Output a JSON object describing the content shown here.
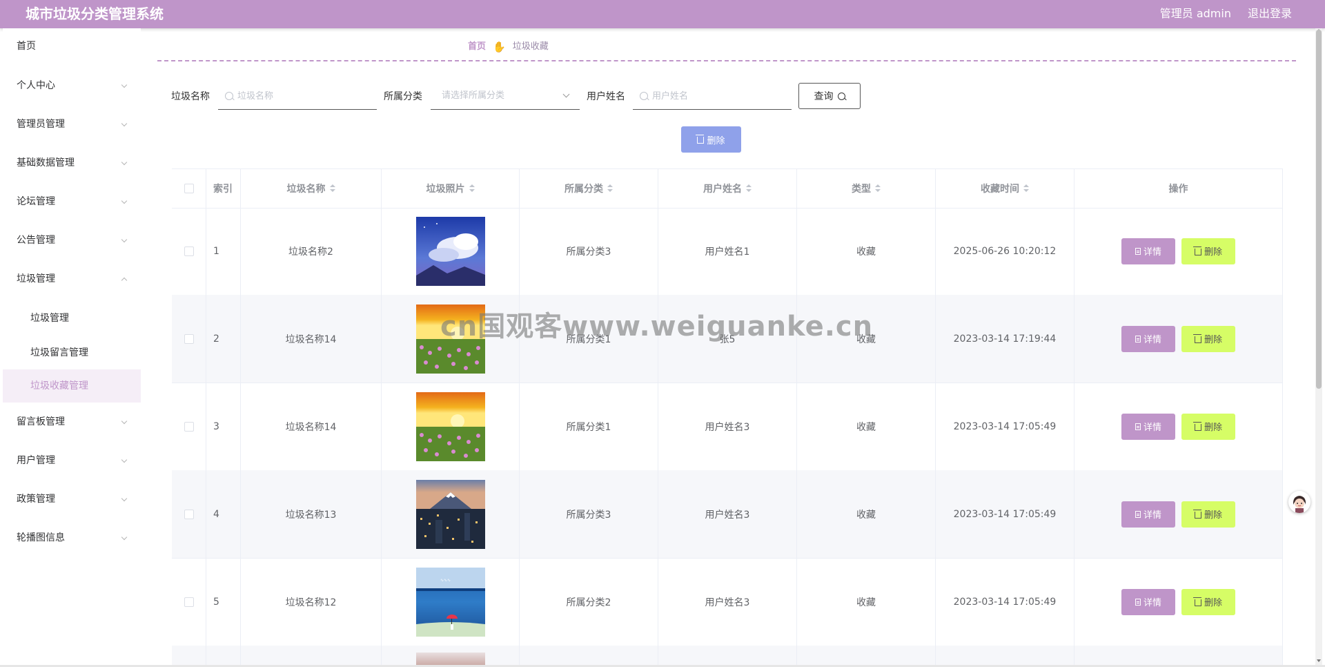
{
  "app": {
    "title": "城市垃圾分类管理系统"
  },
  "header": {
    "user_label": "管理员 admin",
    "logout_label": "退出登录"
  },
  "sidebar": {
    "items": [
      {
        "label": "首页",
        "expandable": false
      },
      {
        "label": "个人中心",
        "expandable": true
      },
      {
        "label": "管理员管理",
        "expandable": true
      },
      {
        "label": "基础数据管理",
        "expandable": true
      },
      {
        "label": "论坛管理",
        "expandable": true
      },
      {
        "label": "公告管理",
        "expandable": true
      },
      {
        "label": "垃圾管理",
        "expandable": true,
        "expanded": true
      },
      {
        "label": "垃圾管理",
        "sub": true
      },
      {
        "label": "垃圾留言管理",
        "sub": true
      },
      {
        "label": "垃圾收藏管理",
        "sub": true,
        "active": true
      },
      {
        "label": "留言板管理",
        "expandable": true
      },
      {
        "label": "用户管理",
        "expandable": true
      },
      {
        "label": "政策管理",
        "expandable": true
      },
      {
        "label": "轮播图信息",
        "expandable": true
      }
    ]
  },
  "breadcrumb": {
    "home": "首页",
    "separator_icon": "hand-pointer-icon",
    "current": "垃圾收藏"
  },
  "search": {
    "name_label": "垃圾名称",
    "name_placeholder": "垃圾名称",
    "category_label": "所属分类",
    "category_placeholder": "请选择所属分类",
    "user_label": "用户姓名",
    "user_placeholder": "用户姓名",
    "query_label": "查询"
  },
  "toolbar": {
    "delete_label": "删除"
  },
  "table": {
    "headers": {
      "index": "索引",
      "name": "垃圾名称",
      "photo": "垃圾照片",
      "category": "所属分类",
      "user": "用户姓名",
      "type": "类型",
      "time": "收藏时间",
      "actions": "操作"
    },
    "rows": [
      {
        "index": "1",
        "name": "垃圾名称2",
        "photo": "anime-sky-clouds",
        "category": "所属分类3",
        "user": "用户姓名1",
        "type": "收藏",
        "time": "2025-06-26 10:20:12"
      },
      {
        "index": "2",
        "name": "垃圾名称14",
        "photo": "sunset-flower-field",
        "category": "所属分类1",
        "user": "张5",
        "type": "收藏",
        "time": "2023-03-14 17:19:44"
      },
      {
        "index": "3",
        "name": "垃圾名称14",
        "photo": "sunset-flower-field",
        "category": "所属分类1",
        "user": "用户姓名3",
        "type": "收藏",
        "time": "2023-03-14 17:05:49"
      },
      {
        "index": "4",
        "name": "垃圾名称13",
        "photo": "mountain-city-night",
        "category": "所属分类3",
        "user": "用户姓名3",
        "type": "收藏",
        "time": "2023-03-14 17:05:49"
      },
      {
        "index": "5",
        "name": "垃圾名称12",
        "photo": "blue-sea-umbrella",
        "category": "所属分类2",
        "user": "用户姓名3",
        "type": "收藏",
        "time": "2023-03-14 17:05:49"
      }
    ],
    "detail_label": "详情",
    "row_delete_label": "删除"
  },
  "watermark": "cn国观客www.weiguanke.cn",
  "colors": {
    "primary": "#bf95c9",
    "bulk_delete": "#8fa1ea",
    "row_delete": "#d6fd66",
    "row_alt": "#f6f7fa"
  }
}
